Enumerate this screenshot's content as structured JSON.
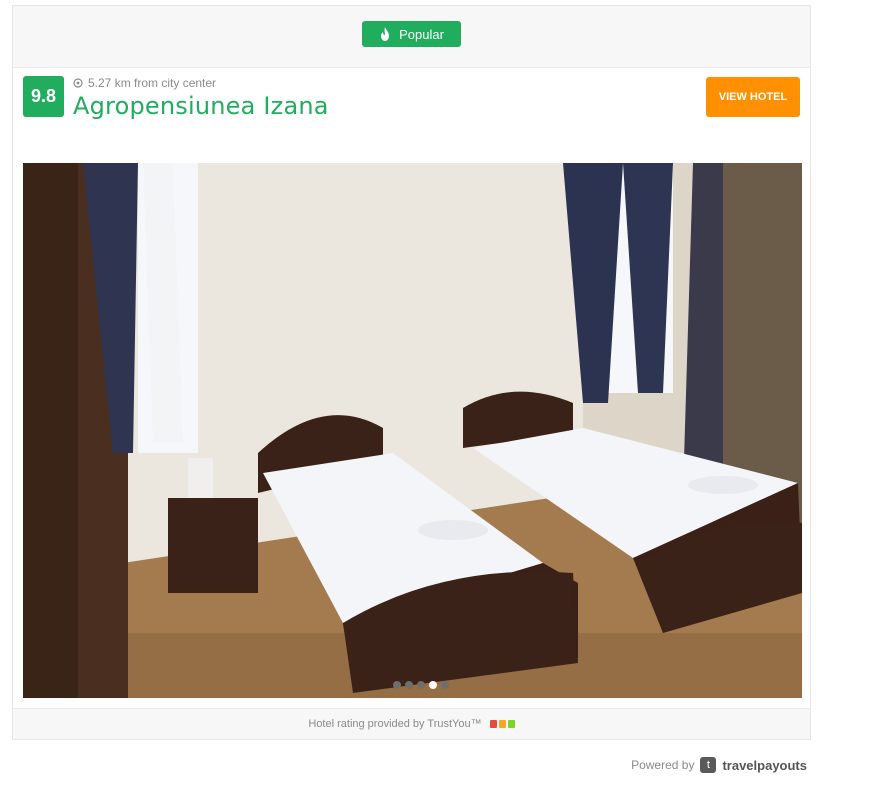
{
  "badge": {
    "label": "Popular",
    "icon": "flame-icon",
    "color": "#20ad5e"
  },
  "hotel": {
    "rating": "9.8",
    "distance": "5.27 km from city center",
    "name": "Agropensiunea Izana",
    "view_button": "VIEW HOTEL"
  },
  "gallery": {
    "image_alt": "Hotel room with two single beds",
    "dots": [
      false,
      false,
      false,
      true,
      false
    ]
  },
  "footer": {
    "rating_provider": "Hotel rating provided by TrustYou™",
    "bar_colors": [
      "#e64b3c",
      "#f5a623",
      "#7ed321"
    ]
  },
  "powered": {
    "label": "Powered by",
    "brand": "travelpayouts"
  },
  "colors": {
    "accent": "#20ad5e",
    "button": "#ff9000"
  }
}
